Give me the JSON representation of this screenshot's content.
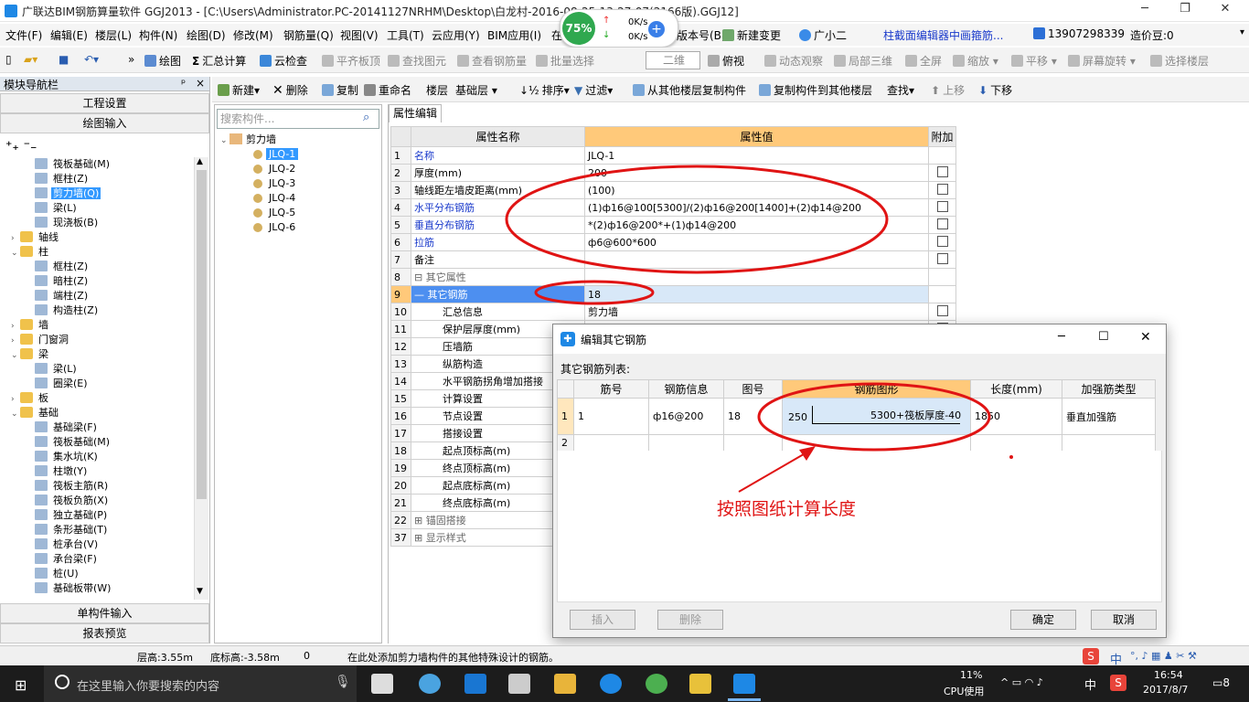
{
  "window": {
    "title": "广联达BIM钢筋算量软件 GGJ2013 - [C:\\Users\\Administrator.PC-20141127NRHM\\Desktop\\白龙村-2016-08-25-13-27-07(2166版).GGJ12]",
    "minimize": "─",
    "restore": "❐",
    "close": "✕"
  },
  "net_widget": {
    "percent": "75%",
    "up": "0K/s",
    "down": "0K/s"
  },
  "menu": [
    "文件(F)",
    "编辑(E)",
    "楼层(L)",
    "构件(N)",
    "绘图(D)",
    "修改(M)",
    "钢筋量(Q)",
    "视图(V)",
    "工具(T)",
    "云应用(Y)",
    "BIM应用(I)",
    "在"
  ],
  "menu_right": {
    "version": "版本号(B)",
    "change": "新建变更",
    "assistant": "广小二",
    "promo": "柱截面编辑器中画箍筋...",
    "phone": "13907298339",
    "price": "造价豆:0"
  },
  "toolbar1": {
    "draw": "绘图",
    "sum": "汇总计算",
    "cloud": "云检查",
    "flat": "平齐板顶",
    "find": "查找图元",
    "view_rebar": "查看钢筋量",
    "batch": "批量选择",
    "mode": "二维",
    "top_view": "俯视",
    "dynamic": "动态观察",
    "local3d": "局部三维",
    "fullscreen": "全屏",
    "zoom": "缩放",
    "pan": "平移",
    "rotate": "屏幕旋转",
    "select_floor": "选择楼层"
  },
  "toolbar2": {
    "new": "新建",
    "delete": "删除",
    "copy": "复制",
    "rename": "重命名",
    "floor": "楼层",
    "floor_value": "基础层",
    "sort": "排序",
    "filter": "过滤",
    "copy_from": "从其他楼层复制构件",
    "copy_to": "复制构件到其他楼层",
    "find": "查找",
    "up": "上移",
    "down": "下移"
  },
  "left_panel": {
    "title": "模块导航栏",
    "pin": "ᵖ",
    "close": "×",
    "project": "工程设置",
    "draw_input": "绘图输入",
    "single_input": "单构件输入",
    "report": "报表预览",
    "tree": [
      {
        "label": "筏板基础(M)",
        "indent": 2,
        "type": "leaf"
      },
      {
        "label": "框柱(Z)",
        "indent": 2,
        "type": "leaf"
      },
      {
        "label": "剪力墙(Q)",
        "indent": 2,
        "type": "leaf",
        "selected": true
      },
      {
        "label": "梁(L)",
        "indent": 2,
        "type": "leaf"
      },
      {
        "label": "现浇板(B)",
        "indent": 2,
        "type": "leaf"
      },
      {
        "label": "轴线",
        "indent": 1,
        "type": "folder",
        "exp": "›"
      },
      {
        "label": "柱",
        "indent": 1,
        "type": "folder",
        "exp": "⌄"
      },
      {
        "label": "框柱(Z)",
        "indent": 2,
        "type": "leaf"
      },
      {
        "label": "暗柱(Z)",
        "indent": 2,
        "type": "leaf"
      },
      {
        "label": "端柱(Z)",
        "indent": 2,
        "type": "leaf"
      },
      {
        "label": "构造柱(Z)",
        "indent": 2,
        "type": "leaf"
      },
      {
        "label": "墙",
        "indent": 1,
        "type": "folder",
        "exp": "›"
      },
      {
        "label": "门窗洞",
        "indent": 1,
        "type": "folder",
        "exp": "›"
      },
      {
        "label": "梁",
        "indent": 1,
        "type": "folder",
        "exp": "⌄"
      },
      {
        "label": "梁(L)",
        "indent": 2,
        "type": "leaf"
      },
      {
        "label": "圈梁(E)",
        "indent": 2,
        "type": "leaf"
      },
      {
        "label": "板",
        "indent": 1,
        "type": "folder",
        "exp": "›"
      },
      {
        "label": "基础",
        "indent": 1,
        "type": "folder",
        "exp": "⌄"
      },
      {
        "label": "基础梁(F)",
        "indent": 2,
        "type": "leaf"
      },
      {
        "label": "筏板基础(M)",
        "indent": 2,
        "type": "leaf"
      },
      {
        "label": "集水坑(K)",
        "indent": 2,
        "type": "leaf"
      },
      {
        "label": "柱墩(Y)",
        "indent": 2,
        "type": "leaf"
      },
      {
        "label": "筏板主筋(R)",
        "indent": 2,
        "type": "leaf"
      },
      {
        "label": "筏板负筋(X)",
        "indent": 2,
        "type": "leaf"
      },
      {
        "label": "独立基础(P)",
        "indent": 2,
        "type": "leaf"
      },
      {
        "label": "条形基础(T)",
        "indent": 2,
        "type": "leaf"
      },
      {
        "label": "桩承台(V)",
        "indent": 2,
        "type": "leaf"
      },
      {
        "label": "承台梁(F)",
        "indent": 2,
        "type": "leaf"
      },
      {
        "label": "桩(U)",
        "indent": 2,
        "type": "leaf"
      },
      {
        "label": "基础板带(W)",
        "indent": 2,
        "type": "leaf"
      }
    ]
  },
  "mid_panel": {
    "search_placeholder": "搜索构件...",
    "root": "剪力墙",
    "items": [
      "JLQ-1",
      "JLQ-2",
      "JLQ-3",
      "JLQ-4",
      "JLQ-5",
      "JLQ-6"
    ],
    "selected": 0
  },
  "prop_tab": "属性编辑",
  "prop_table": {
    "headers": [
      "属性名称",
      "属性值",
      "附加"
    ],
    "rows": [
      {
        "no": "1",
        "name": "名称",
        "value": "JLQ-1",
        "blue": true,
        "cb": false
      },
      {
        "no": "2",
        "name": "厚度(mm)",
        "value": "200",
        "blue": false,
        "cb": true
      },
      {
        "no": "3",
        "name": "轴线距左墙皮距离(mm)",
        "value": "(100)",
        "blue": false,
        "cb": true
      },
      {
        "no": "4",
        "name": "水平分布钢筋",
        "value": "(1)ф16@100[5300]/(2)ф16@200[1400]+(2)ф14@200",
        "blue": true,
        "cb": true
      },
      {
        "no": "5",
        "name": "垂直分布钢筋",
        "value": "*(2)ф16@200*+(1)ф14@200",
        "blue": true,
        "cb": true
      },
      {
        "no": "6",
        "name": "拉筋",
        "value": "ф6@600*600",
        "blue": true,
        "cb": true
      },
      {
        "no": "7",
        "name": "备注",
        "value": "",
        "blue": false,
        "cb": true
      },
      {
        "no": "8",
        "name": "⊟ 其它属性",
        "value": "",
        "blue": false,
        "cb": false,
        "gray": true
      },
      {
        "no": "9",
        "name": "— 其它钢筋",
        "value": "18",
        "blue": false,
        "cb": false,
        "selected": true
      },
      {
        "no": "10",
        "name": "汇总信息",
        "value": "剪力墙",
        "blue": false,
        "cb": true
      },
      {
        "no": "11",
        "name": "保护层厚度(mm)",
        "value": "",
        "blue": false,
        "cb": true
      },
      {
        "no": "12",
        "name": "压墙筋",
        "value": "",
        "blue": false,
        "cb": false
      },
      {
        "no": "13",
        "name": "纵筋构造",
        "value": "",
        "blue": false,
        "cb": false
      },
      {
        "no": "14",
        "name": "水平钢筋拐角增加搭接",
        "value": "",
        "blue": false,
        "cb": false
      },
      {
        "no": "15",
        "name": "计算设置",
        "value": "",
        "blue": false,
        "cb": false
      },
      {
        "no": "16",
        "name": "节点设置",
        "value": "",
        "blue": false,
        "cb": false
      },
      {
        "no": "17",
        "name": "搭接设置",
        "value": "",
        "blue": false,
        "cb": false
      },
      {
        "no": "18",
        "name": "起点顶标高(m)",
        "value": "",
        "blue": false,
        "cb": false
      },
      {
        "no": "19",
        "name": "终点顶标高(m)",
        "value": "",
        "blue": false,
        "cb": false
      },
      {
        "no": "20",
        "name": "起点底标高(m)",
        "value": "",
        "blue": false,
        "cb": false
      },
      {
        "no": "21",
        "name": "终点底标高(m)",
        "value": "",
        "blue": false,
        "cb": false
      },
      {
        "no": "22",
        "name": "⊞ 锚固搭接",
        "value": "",
        "blue": false,
        "cb": false,
        "gray": true
      },
      {
        "no": "37",
        "name": "⊞ 显示样式",
        "value": "",
        "blue": false,
        "cb": false,
        "gray": true
      }
    ]
  },
  "dialog": {
    "title": "编辑其它钢筋",
    "list_label": "其它钢筋列表:",
    "headers": [
      "筋号",
      "钢筋信息",
      "图号",
      "钢筋图形",
      "长度(mm)",
      "加强筋类型"
    ],
    "rows": [
      {
        "no": "1",
        "bar": "1",
        "info": "ф16@200",
        "fig": "18",
        "shape_left": "250",
        "shape_right": "5300+筏板厚度-40",
        "length": "1850",
        "type": "垂直加强筋"
      },
      {
        "no": "2",
        "bar": "",
        "info": "",
        "fig": "",
        "shape_left": "",
        "shape_right": "",
        "length": "",
        "type": ""
      }
    ],
    "insert": "插入",
    "delete": "删除",
    "ok": "确定",
    "cancel": "取消"
  },
  "annotation": "按照图纸计算长度",
  "status": {
    "floor_height": "层高:3.55m",
    "bottom_elev": "底标高:-3.58m",
    "zero": "0",
    "hint": "在此处添加剪力墙构件的其他特殊设计的钢筋。",
    "ime": "中"
  },
  "taskbar": {
    "search_placeholder": "在这里输入你要搜索的内容",
    "cpu": "11%",
    "cpu_label": "CPU使用",
    "lang": "中",
    "time": "16:54",
    "date": "2017/8/7",
    "notif": "8"
  },
  "colors": {
    "accent": "#3399ff",
    "header_orange": "#ffc97a",
    "annotation_red": "#e01414",
    "taskbar": "#1c1c1c"
  }
}
